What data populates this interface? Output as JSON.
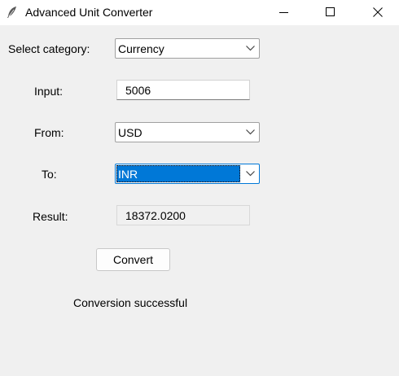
{
  "window": {
    "title": "Advanced Unit Converter",
    "icon": "feather-icon",
    "controls": [
      "minimize-icon",
      "maximize-icon",
      "close-icon"
    ]
  },
  "form": {
    "category_label": "Select category:",
    "category_value": "Currency",
    "input_label": "Input:",
    "input_value": "5006",
    "from_label": "From:",
    "from_value": "USD",
    "to_label": "To:",
    "to_value": "INR",
    "result_label": "Result:",
    "result_value": "18372.0200",
    "convert_button": "Convert",
    "status_text": "Conversion successful"
  },
  "colors": {
    "accent": "#0078d7",
    "window_bg": "#f0f0f0"
  }
}
